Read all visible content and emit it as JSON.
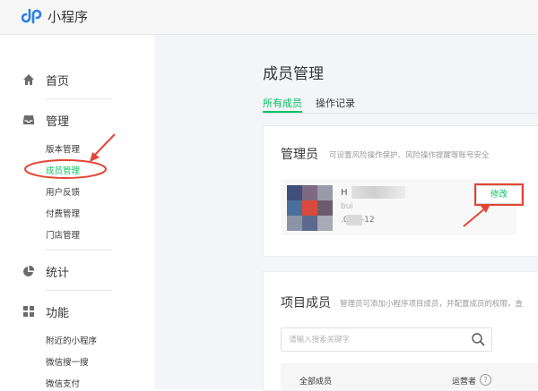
{
  "header": {
    "app_title": "小程序"
  },
  "sidebar": {
    "home": "首页",
    "manage": "管理",
    "manage_items": [
      "版本管理",
      "成员管理",
      "用户反馈",
      "付费管理",
      "门店管理"
    ],
    "stats": "统计",
    "features": "功能",
    "feature_items": [
      "附近的小程序",
      "微信搜一搜",
      "微信支付"
    ]
  },
  "main": {
    "title": "成员管理",
    "tabs": [
      "所有成员",
      "操作记录"
    ],
    "admin": {
      "title": "管理员",
      "desc": "可设置风险操作保护、风险操作提醒等账号安全",
      "name_partial": "H",
      "id_partial": "bui",
      "date_partial": ".0    11-12",
      "edit_label": "修改"
    },
    "project": {
      "title": "项目成员",
      "desc": "管理员可添加小程序项目成员，并配置成员的权限，查",
      "search_placeholder": "请输入搜索关键字",
      "col_all": "全部成员",
      "col_ops": "运营者",
      "help": "?"
    }
  },
  "colors": {
    "accent": "#07c160",
    "annotation": "#e34534"
  }
}
